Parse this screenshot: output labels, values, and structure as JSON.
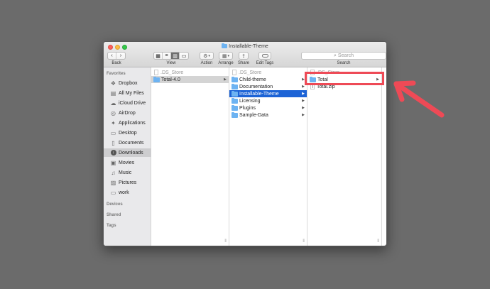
{
  "window": {
    "title": "Installable-Theme"
  },
  "toolbar": {
    "back_label": "Back",
    "view_label": "View",
    "action_label": "Action",
    "arrange_label": "Arrange",
    "share_label": "Share",
    "edit_tags_label": "Edit Tags",
    "search_label": "Search",
    "search_placeholder": "Search"
  },
  "sidebar": {
    "favorites_header": "Favorites",
    "items": [
      {
        "label": "Dropbox",
        "icon": "dropbox-icon"
      },
      {
        "label": "All My Files",
        "icon": "all-files-icon"
      },
      {
        "label": "iCloud Drive",
        "icon": "cloud-icon"
      },
      {
        "label": "AirDrop",
        "icon": "airdrop-icon"
      },
      {
        "label": "Applications",
        "icon": "applications-icon"
      },
      {
        "label": "Desktop",
        "icon": "desktop-icon"
      },
      {
        "label": "Documents",
        "icon": "documents-icon"
      },
      {
        "label": "Downloads",
        "icon": "downloads-icon",
        "selected": true
      },
      {
        "label": "Movies",
        "icon": "movies-icon"
      },
      {
        "label": "Music",
        "icon": "music-icon"
      },
      {
        "label": "Pictures",
        "icon": "pictures-icon"
      },
      {
        "label": "work",
        "icon": "folder-icon"
      }
    ],
    "devices_header": "Devices",
    "shared_header": "Shared",
    "tags_header": "Tags"
  },
  "columns": [
    {
      "items": [
        {
          "label": ".DS_Store",
          "type": "file",
          "dim": true
        },
        {
          "label": "Total-4.0",
          "type": "folder",
          "highlighted": true,
          "has_children": true
        }
      ]
    },
    {
      "items": [
        {
          "label": ".DS_Store",
          "type": "file",
          "dim": true
        },
        {
          "label": "Child-theme",
          "type": "folder",
          "has_children": true
        },
        {
          "label": "Documentation",
          "type": "folder",
          "has_children": true
        },
        {
          "label": "Installable-Theme",
          "type": "folder",
          "selected": true,
          "has_children": true
        },
        {
          "label": "Licensing",
          "type": "folder",
          "has_children": true
        },
        {
          "label": "Plugins",
          "type": "folder",
          "has_children": true
        },
        {
          "label": "Sample-Data",
          "type": "folder",
          "has_children": true
        }
      ]
    },
    {
      "items": [
        {
          "label": ".DS_Store",
          "type": "file",
          "dim": true
        },
        {
          "label": "Total",
          "type": "folder",
          "has_children": true
        },
        {
          "label": "Total.zip",
          "type": "zip"
        }
      ]
    }
  ],
  "annotation": {
    "highlight_color": "#ee4a56"
  }
}
